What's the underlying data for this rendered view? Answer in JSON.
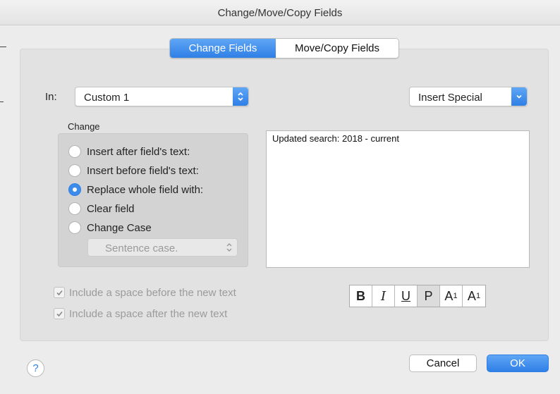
{
  "window": {
    "title": "Change/Move/Copy Fields"
  },
  "tabs": [
    {
      "label": "Change Fields",
      "active": true
    },
    {
      "label": "Move/Copy Fields",
      "active": false
    }
  ],
  "field_select": {
    "label": "In:",
    "value": "Custom 1"
  },
  "insert_special": {
    "label": "Insert Special"
  },
  "change_group": {
    "title": "Change",
    "options": [
      {
        "label": "Insert after field's text:",
        "checked": false
      },
      {
        "label": "Insert before field's text:",
        "checked": false
      },
      {
        "label": "Replace whole field with:",
        "checked": true
      },
      {
        "label": "Clear field",
        "checked": false
      },
      {
        "label": "Change Case",
        "checked": false
      }
    ],
    "case_select": {
      "value": "Sentence case."
    }
  },
  "replacement_text": {
    "value": "Updated search: 2018 - current"
  },
  "space_options": [
    {
      "label": "Include a space before the new text",
      "checked": true
    },
    {
      "label": "Include a space after the new text",
      "checked": true
    }
  ],
  "format_buttons": [
    {
      "label": "B",
      "meaning": "bold"
    },
    {
      "label": "I",
      "meaning": "italic"
    },
    {
      "label": "U",
      "meaning": "underline"
    },
    {
      "label": "P",
      "meaning": "plain"
    },
    {
      "label": "A",
      "meaning": "superscript",
      "script": "1"
    },
    {
      "label": "A",
      "meaning": "subscript",
      "script": "1"
    }
  ],
  "footer": {
    "help": "?",
    "cancel": "Cancel",
    "ok": "OK"
  },
  "colors": {
    "accent": "#2f7fe6",
    "panel": "#e2e2e2",
    "background": "#ececec"
  }
}
